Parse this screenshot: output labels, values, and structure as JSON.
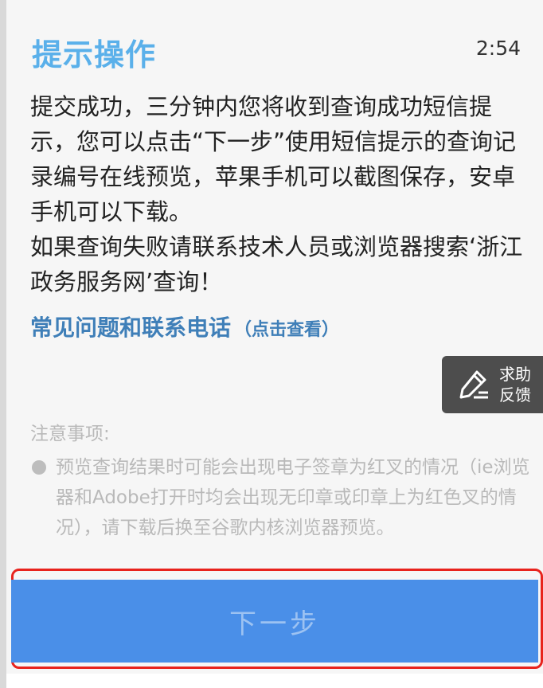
{
  "dialog": {
    "title": "提示操作",
    "time": "2:54",
    "message_lines": [
      "提交成功，三分钟内您将收到查询成功短信提示，您可以点击“下一步”使用短信提示的查询记录编号在线预览，苹果手机可以截图保存，安卓手机可以下载。",
      "如果查询失败请联系技术人员或浏览器搜索‘浙江政务服务网’查询！"
    ],
    "faq": {
      "label": "常见问题和联系电话",
      "hint": "（点击查看）"
    },
    "help_button": {
      "icon": "edit-pen-icon",
      "label": "求助反馈"
    },
    "notes": {
      "title": "注意事项:",
      "item": "预览查询结果时可能会出现电子签章为红叉的情况（ie浏览器和Adobe打开时均会出现无印章或印章上为红色叉的情况），请下载后换至谷歌内核浏览器预览。"
    },
    "next_button": {
      "label": "下一步"
    }
  },
  "colors": {
    "title": "#5ab0ea",
    "link": "#3f7fb8",
    "button": "#4a8fe8",
    "highlight_frame": "#e8231d"
  }
}
